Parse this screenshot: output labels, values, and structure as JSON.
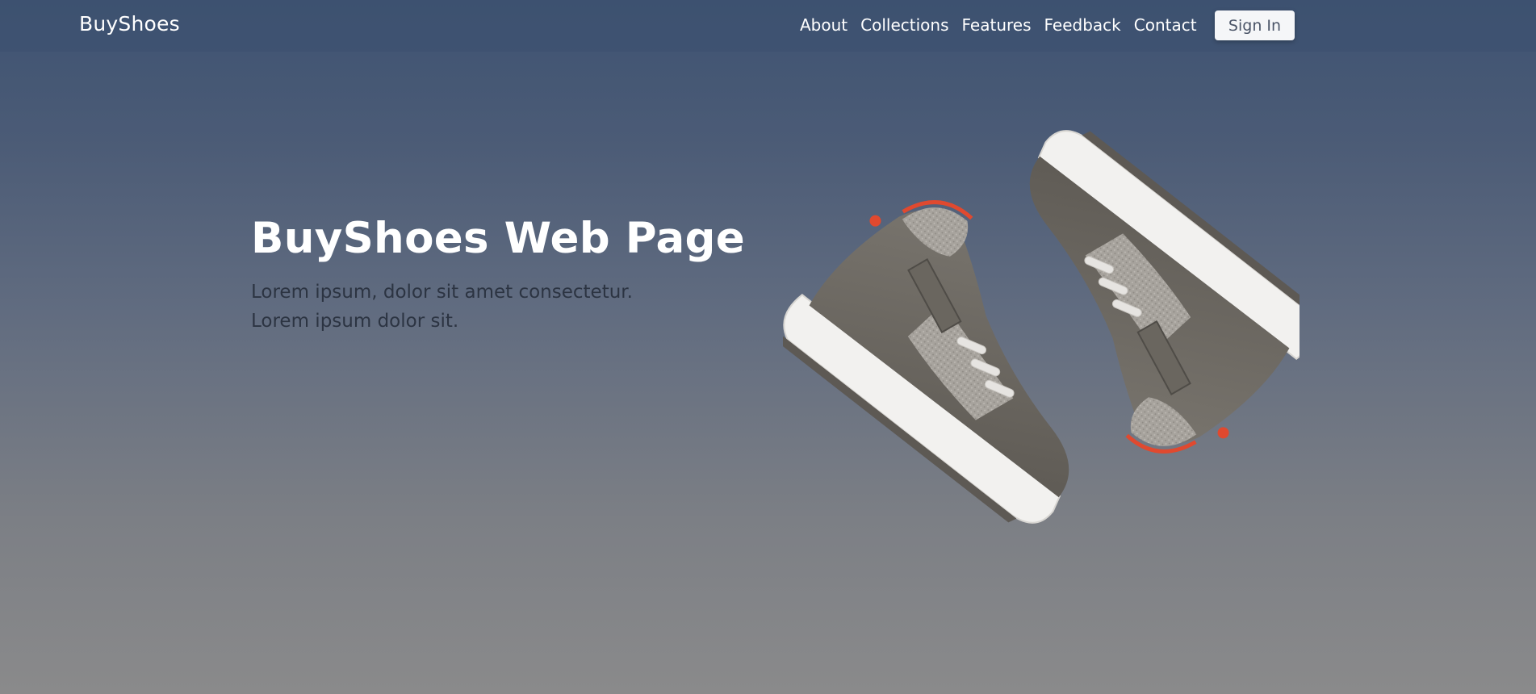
{
  "navbar": {
    "brand": "BuyShoes",
    "links": [
      "About",
      "Collections",
      "Features",
      "Feedback",
      "Contact"
    ],
    "signin_label": "Sign In"
  },
  "hero": {
    "title": "BuyShoes Web Page",
    "subtitle_line1": "Lorem ipsum, dolor sit amet consectetur.",
    "subtitle_line2": "Lorem ipsum dolor sit.",
    "image": "pair-of-grey-sneakers"
  },
  "colors": {
    "navbar_bg": "#3e5372",
    "gradient_bottom": "#8a8a8b",
    "subtitle_text": "#2c3442",
    "button_bg": "#f5f6f8",
    "button_text": "#4b5568",
    "shoe_suede": "#6f6b64",
    "shoe_sole": "#f2f1ef",
    "shoe_accent": "#e0492f"
  }
}
